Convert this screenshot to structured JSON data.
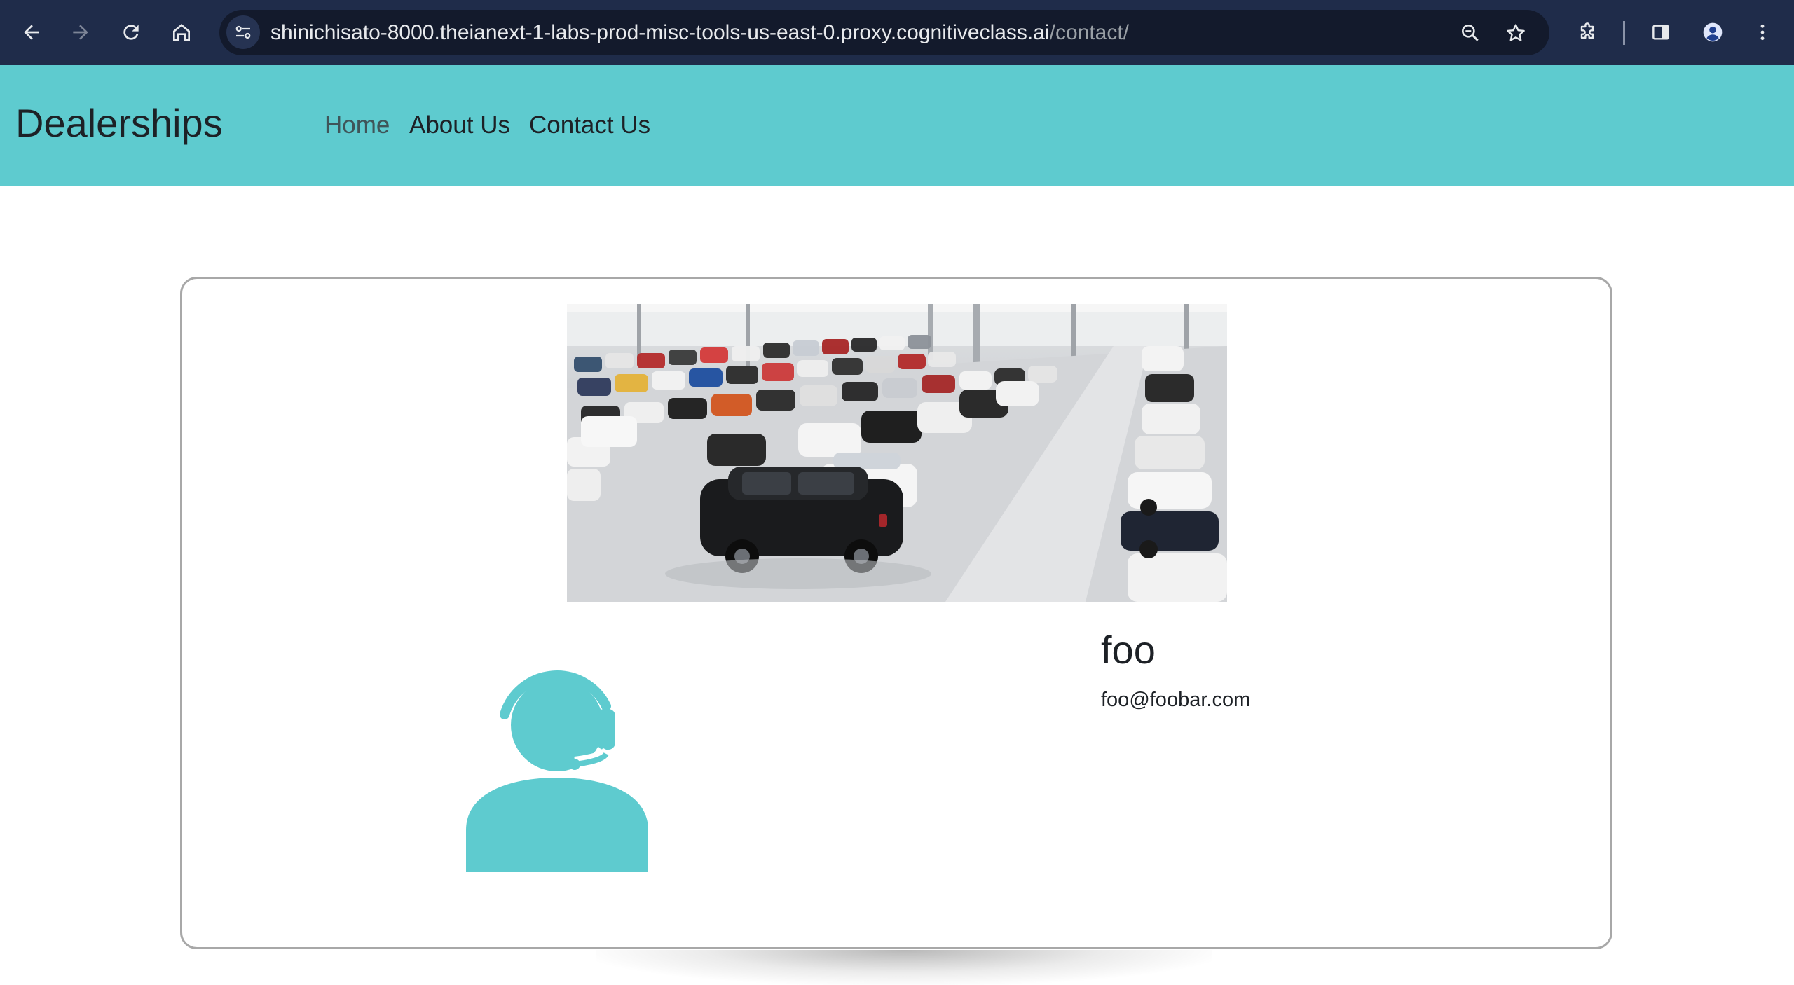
{
  "browser": {
    "url_host": "shinichisato-8000.theianext-1-labs-prod-misc-tools-us-east-0.proxy.cognitiveclass.ai",
    "url_path": "/contact/",
    "icons": {
      "back": "arrow-left-icon",
      "forward": "arrow-right-icon",
      "reload": "reload-icon",
      "home": "home-icon",
      "site_info": "tune-icon",
      "zoom": "zoom-icon",
      "bookmark": "star-icon",
      "extensions": "puzzle-icon",
      "side_panel": "side-panel-icon",
      "profile": "profile-icon",
      "menu": "kebab-menu-icon"
    }
  },
  "navbar": {
    "brand": "Dealerships",
    "links": [
      {
        "label": "Home"
      },
      {
        "label": "About Us"
      },
      {
        "label": "Contact Us"
      }
    ],
    "background": "#5ecbcf"
  },
  "contact": {
    "name": "foo",
    "email": "foo@foobar.com",
    "accent_color": "#5ecbcf"
  }
}
